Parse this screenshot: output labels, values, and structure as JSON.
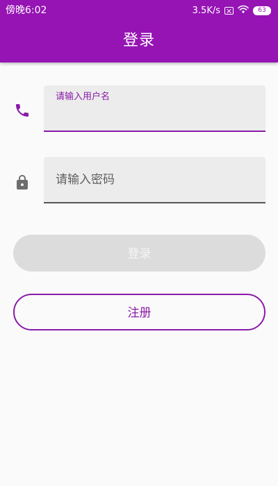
{
  "status_bar": {
    "time": "傍晚6:02",
    "network_speed": "3.5K/s",
    "battery": "63"
  },
  "app_bar": {
    "title": "登录"
  },
  "form": {
    "username": {
      "label": "请输入用户名",
      "value": "",
      "icon": "phone-icon"
    },
    "password": {
      "placeholder": "请输入密码",
      "value": "",
      "icon": "lock-icon"
    }
  },
  "buttons": {
    "login_label": "登录",
    "register_label": "注册"
  },
  "colors": {
    "primary": "#9614b4",
    "accent": "#8a1aa8",
    "background": "#fafafa",
    "field_fill": "#ececec",
    "disabled_button": "#dcdcdc"
  }
}
